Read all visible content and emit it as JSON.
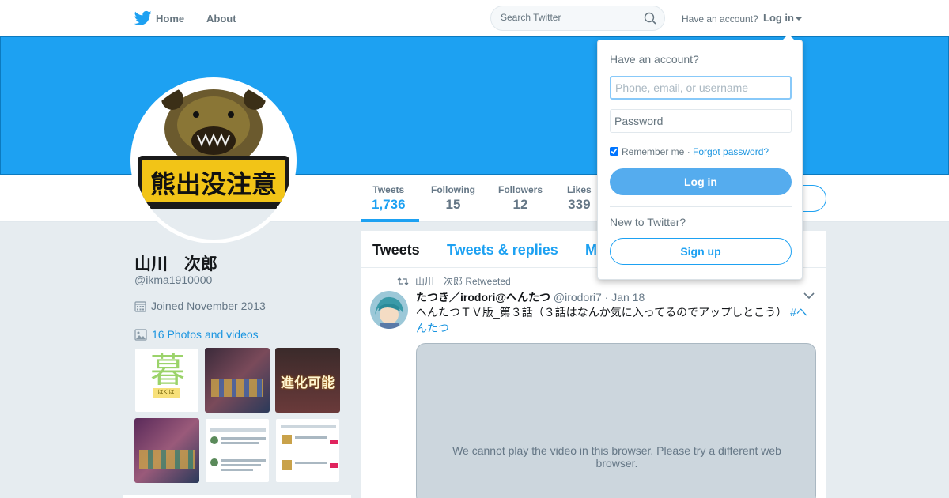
{
  "nav": {
    "home": "Home",
    "about": "About",
    "search_placeholder": "Search Twitter",
    "have_account": "Have an account?",
    "login": "Log in"
  },
  "profile": {
    "name": "山川　次郎",
    "handle": "@ikma1910000",
    "joined": "Joined November 2013",
    "photos_link": "16 Photos and videos",
    "avatar_text": "熊出没注意",
    "stats": [
      {
        "label": "Tweets",
        "value": "1,736"
      },
      {
        "label": "Following",
        "value": "15"
      },
      {
        "label": "Followers",
        "value": "12"
      },
      {
        "label": "Likes",
        "value": "339"
      }
    ]
  },
  "thumbnails": [
    {
      "text": "暮",
      "caption": "ほくほ"
    },
    {
      "text": ""
    },
    {
      "text": "進化可能"
    },
    {
      "text": ""
    },
    {
      "text": ""
    },
    {
      "text": ""
    }
  ],
  "timeline": {
    "tabs": [
      "Tweets",
      "Tweets & replies",
      "M"
    ],
    "tweet": {
      "retweet_line": "山川　次郎 Retweeted",
      "name": "たつき／irodori@へんたつ",
      "handle": "@irodori7",
      "date": "· Jan 18",
      "text": "へんたつＴＶ版_第３話（３話はなんか気に入ってるのでアップしとこう）",
      "hashtag": "#へんたつ",
      "video_message": "We cannot play the video in this browser. Please try a different web browser."
    }
  },
  "login_dropdown": {
    "title": "Have an account?",
    "username_placeholder": "Phone, email, or username",
    "password_placeholder": "Password",
    "remember": "Remember me",
    "separator": " · ",
    "forgot": "Forgot password?",
    "login_button": "Log in",
    "new_to_twitter": "New to Twitter?",
    "signup_button": "Sign up"
  },
  "colors": {
    "brand_blue": "#1da1f2",
    "link_blue": "#1b95e0",
    "background": "#e6ecf0",
    "muted_text": "#657786"
  }
}
